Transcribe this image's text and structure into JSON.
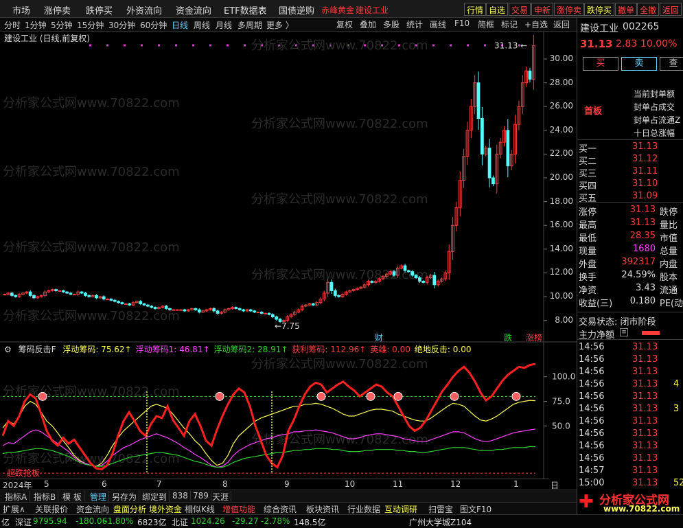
{
  "menu": {
    "items": [
      "市场",
      "涨停卖",
      "跌停买",
      "外资流向",
      "资金流向",
      "ETF数据表",
      "国债逆购"
    ],
    "pinned1": "赤峰黄金",
    "pinned2": "建设工业"
  },
  "switches": [
    "行情",
    "自选",
    "交易",
    "申新",
    "涨停卖",
    "跌停买",
    "撤单",
    "全撤",
    "返回"
  ],
  "periods": [
    "分时",
    "1分钟",
    "5分钟",
    "15分钟",
    "30分钟",
    "60分钟",
    "日线",
    "周线",
    "月线",
    "多周期",
    "更多 〉"
  ],
  "active_period": "日线",
  "toolbar": [
    "复权",
    "叠加",
    "多股",
    "统计",
    "画线",
    "F10",
    "简框",
    "标记",
    "+自选",
    "返回"
  ],
  "chart_title": "建设工业 (日线,前复权)",
  "watermark": "分析家公式网www.70822.com",
  "price_axis": [
    "30.00",
    "28.00",
    "26.00",
    "24.00",
    "22.00",
    "20.00",
    "18.00",
    "16.00",
    "14.00",
    "12.00",
    "10.00",
    "8.00"
  ],
  "max_label": "31.13",
  "min_label": "7.75",
  "markers": {
    "cai": "财",
    "die": "跌",
    "zhang": "涨榜"
  },
  "indicator": {
    "name": "筹码反击F",
    "fields": [
      {
        "label": "浮动筹码: 75.62↑",
        "color": "#fcfc54"
      },
      {
        "label": "浮动筹码1: 46.81↑",
        "color": "#ff40ff"
      },
      {
        "label": "浮动筹码2: 28.91↑",
        "color": "#2fd22f"
      },
      {
        "label": "获利筹码: 112.96↑",
        "color": "#ff3c3c"
      },
      {
        "label": "英雄: 0.00",
        "color": "#ff3c3c"
      },
      {
        "label": "绝地反击: 0.00",
        "color": "#fcfc54"
      }
    ],
    "axis": [
      "100.0",
      "75.0",
      "50.0",
      "25.0"
    ],
    "bottom_label": "超跌抢板"
  },
  "dates": [
    "2024年",
    "5",
    "6",
    "7",
    "8",
    "9",
    "10",
    "11",
    "12",
    "1"
  ],
  "date_period": "日线",
  "tabs": [
    "指标A",
    "指标B",
    "模 板",
    "管理",
    "另存为",
    "绑定到",
    "838",
    "789",
    "天涯"
  ],
  "active_tab": "管理",
  "funcs": [
    {
      "label": "扩展∧",
      "c": ""
    },
    {
      "label": "关联报价",
      "c": ""
    },
    {
      "label": "资金流向",
      "c": ""
    },
    {
      "label": "盘面分析",
      "c": "y"
    },
    {
      "label": "境外资金",
      "c": "y"
    },
    {
      "label": "相似K线",
      "c": ""
    },
    {
      "label": "增值功能",
      "c": "rd"
    },
    {
      "label": "综合资讯",
      "c": ""
    },
    {
      "label": "板块资讯",
      "c": ""
    },
    {
      "label": "行业数据",
      "c": ""
    },
    {
      "label": "互动调研",
      "c": "y"
    },
    {
      "label": "扫雷宝",
      "c": ""
    },
    {
      "label": "图文F10",
      "c": ""
    }
  ],
  "status": {
    "sh_tail": "亿",
    "sz_name": "深证",
    "sz_val": "9795.94",
    "sz_chg": "-180.06",
    "sz_pct": "-1.80%",
    "sz_amt": "6823亿",
    "bz_name": "北证",
    "bz_val": "1024.26",
    "bz_chg": "-29.27",
    "bz_pct": "-2.78%",
    "bz_amt": "148.5亿",
    "location": "广州大学城Z104"
  },
  "quote": {
    "name": "建设工业",
    "code": "002265",
    "price": "31.13",
    "chg": "2.83",
    "pct": "10.00%",
    "buy": "买",
    "sell": "卖",
    "sec": "首板",
    "notes": [
      "当前封单额",
      "封单占成交",
      "封单占流通Z",
      "十日总涨幅"
    ],
    "bids": [
      [
        "买一",
        "31.13"
      ],
      [
        "买二",
        "31.12"
      ],
      [
        "买三",
        "31.11"
      ],
      [
        "买四",
        "31.10"
      ],
      [
        "买五",
        "31.09"
      ]
    ],
    "stats": [
      [
        "涨停",
        "31.13",
        "跌停"
      ],
      [
        "最高",
        "31.13",
        "量比"
      ],
      [
        "最低",
        "28.35",
        "市值"
      ],
      [
        "现量",
        "1680",
        "总量"
      ],
      [
        "外盘",
        "392317",
        "内盘"
      ],
      [
        "换手",
        "24.59%",
        "股本"
      ],
      [
        "净资",
        "3.43",
        "流通"
      ],
      [
        "收益(三)",
        "0.180",
        "PE(动)"
      ]
    ],
    "trade_state": "交易状态: 闭市阶段",
    "net_flow": "主力净额",
    "ticks": [
      [
        "14:56",
        "31.13",
        ""
      ],
      [
        "14:56",
        "31.13",
        ""
      ],
      [
        "14:56",
        "31.13",
        ""
      ],
      [
        "14:56",
        "31.13",
        "4"
      ],
      [
        "14:56",
        "31.13",
        ""
      ],
      [
        "14:56",
        "31.13",
        "3"
      ],
      [
        "14:56",
        "31.13",
        ""
      ],
      [
        "14:56",
        "31.13",
        ""
      ],
      [
        "14:56",
        "31.13",
        ""
      ],
      [
        "14:56",
        "31.13",
        ""
      ],
      [
        "14:57",
        "31.13",
        ""
      ],
      [
        "15:00",
        "31.13",
        "52"
      ]
    ]
  },
  "logo": {
    "title": "分析家公式网",
    "url": "www.70822.com"
  },
  "chart_data": {
    "type": "candlestick",
    "title": "建设工业 (日线,前复权)",
    "ylim": [
      7.0,
      31.5
    ],
    "y_ticks": [
      8,
      10,
      12,
      14,
      16,
      18,
      20,
      22,
      24,
      26,
      28,
      30
    ],
    "x_ticks": [
      "2024年",
      "5",
      "6",
      "7",
      "8",
      "9",
      "10",
      "11",
      "12",
      "1"
    ],
    "close": [
      10.2,
      10.3,
      10.1,
      10.0,
      10.2,
      10.3,
      10.4,
      10.1,
      9.9,
      10.0,
      10.1,
      10.4,
      10.5,
      10.6,
      10.5,
      10.5,
      10.4,
      10.3,
      10.2,
      10.2,
      10.4,
      10.3,
      10.1,
      10.0,
      10.1,
      9.9,
      10.0,
      9.8,
      9.8,
      9.7,
      9.6,
      9.5,
      9.4,
      9.4,
      9.3,
      9.5,
      9.6,
      9.4,
      9.3,
      9.2,
      9.1,
      9.0,
      9.1,
      9.2,
      9.0,
      8.9,
      8.9,
      8.9,
      8.9,
      8.8,
      8.9,
      9.0,
      8.9,
      8.7,
      8.8,
      8.9,
      9.0,
      8.8,
      8.6,
      8.7,
      8.9,
      9.0,
      9.1,
      9.0,
      8.9,
      8.8,
      8.9,
      8.8,
      8.7,
      8.7,
      8.6,
      8.6,
      8.5,
      8.3,
      8.1,
      7.9,
      8.0,
      8.3,
      8.5,
      8.7,
      8.9,
      9.2,
      9.3,
      9.4,
      9.3,
      9.5,
      9.8,
      10.3,
      11.2,
      10.5,
      10.1,
      10.0,
      10.2,
      10.4,
      10.5,
      10.6,
      10.7,
      10.8,
      11.0,
      11.3,
      11.2,
      11.3,
      11.5,
      11.7,
      11.9,
      12.1,
      11.8,
      12.4,
      12.6,
      12.2,
      12.1,
      11.8,
      11.6,
      11.3,
      11.2,
      11.6,
      11.8,
      11.0,
      11.3,
      11.5,
      12.0,
      13.8,
      16.0,
      17.5,
      19.8,
      21.8,
      24.0,
      26.0,
      28.0,
      25.0,
      22.0,
      22.5,
      20.0,
      19.5,
      22.0,
      23.0,
      24.0,
      21.0,
      22.0,
      24.5,
      26.0,
      28.0,
      29.0,
      28.3,
      31.13
    ],
    "indicator_series": [
      {
        "name": "浮动筹码",
        "values": [
          48,
          55,
          52,
          60,
          70,
          75,
          72,
          64,
          55,
          50,
          43,
          35,
          28,
          20,
          15,
          12,
          10,
          9,
          12,
          20,
          30,
          38,
          45,
          50,
          55,
          60,
          65,
          70,
          72,
          70,
          68,
          62,
          55,
          48,
          42,
          35,
          30,
          22,
          15,
          10,
          12,
          20,
          32,
          40,
          45,
          50,
          55,
          58,
          60,
          62,
          64,
          66,
          68,
          70,
          70,
          72,
          72,
          73,
          72,
          70,
          68,
          65,
          62,
          60,
          60,
          62,
          64,
          66,
          67,
          67,
          66,
          65,
          62,
          60,
          58,
          56,
          55,
          55,
          58,
          62,
          66,
          70,
          73,
          72,
          70,
          65,
          60,
          56,
          55,
          57,
          60,
          64,
          68,
          72,
          74,
          75,
          76,
          75.6
        ]
      },
      {
        "name": "浮动筹码1",
        "values": [
          30,
          33,
          32,
          36,
          40,
          44,
          46,
          44,
          40,
          36,
          32,
          28,
          24,
          18,
          14,
          12,
          10,
          9,
          10,
          14,
          20,
          24,
          28,
          30,
          33,
          36,
          38,
          40,
          42,
          40,
          38,
          35,
          32,
          28,
          25,
          21,
          18,
          14,
          10,
          8,
          9,
          13,
          20,
          25,
          28,
          31,
          33,
          35,
          37,
          38,
          40,
          41,
          42,
          44,
          44,
          45,
          45,
          46,
          45,
          44,
          43,
          41,
          39,
          37,
          37,
          38,
          40,
          41,
          42,
          42,
          41,
          40,
          39,
          37,
          36,
          35,
          34,
          34,
          36,
          38,
          40,
          42,
          44,
          44,
          43,
          40,
          37,
          35,
          34,
          35,
          37,
          39,
          41,
          43,
          44,
          45,
          46,
          46.8
        ]
      },
      {
        "name": "浮动筹码2",
        "values": [
          22,
          23,
          23,
          24,
          25,
          26,
          27,
          27,
          26,
          25,
          23,
          21,
          19,
          16,
          13,
          11,
          10,
          9,
          9,
          10,
          12,
          14,
          16,
          18,
          19,
          20,
          21,
          22,
          23,
          23,
          22,
          21,
          20,
          18,
          16,
          14,
          13,
          11,
          9,
          8,
          8,
          10,
          13,
          15,
          17,
          18,
          19,
          20,
          21,
          22,
          23,
          23,
          24,
          25,
          25,
          26,
          26,
          27,
          27,
          27,
          26,
          26,
          25,
          24,
          24,
          24,
          25,
          25,
          26,
          26,
          26,
          26,
          25,
          25,
          24,
          24,
          23,
          23,
          24,
          25,
          26,
          27,
          28,
          28,
          28,
          27,
          26,
          25,
          25,
          25,
          26,
          26,
          27,
          28,
          28,
          28,
          29,
          28.9
        ]
      },
      {
        "name": "获利筹码",
        "values": [
          40,
          55,
          50,
          60,
          75,
          82,
          78,
          62,
          45,
          35,
          30,
          38,
          32,
          36,
          28,
          20,
          12,
          7,
          6,
          10,
          22,
          40,
          55,
          64,
          55,
          45,
          40,
          52,
          60,
          58,
          70,
          56,
          48,
          40,
          55,
          62,
          50,
          35,
          30,
          46,
          60,
          72,
          82,
          88,
          84,
          70,
          50,
          35,
          20,
          12,
          8,
          20,
          45,
          56,
          70,
          82,
          90,
          94,
          92,
          84,
          88,
          92,
          95,
          90,
          86,
          80,
          84,
          88,
          92,
          90,
          84,
          80,
          70,
          60,
          50,
          45,
          48,
          55,
          65,
          75,
          85,
          92,
          100,
          106,
          110,
          104,
          95,
          84,
          76,
          80,
          88,
          96,
          102,
          106,
          110,
          109,
          112,
          112.96
        ]
      }
    ]
  }
}
